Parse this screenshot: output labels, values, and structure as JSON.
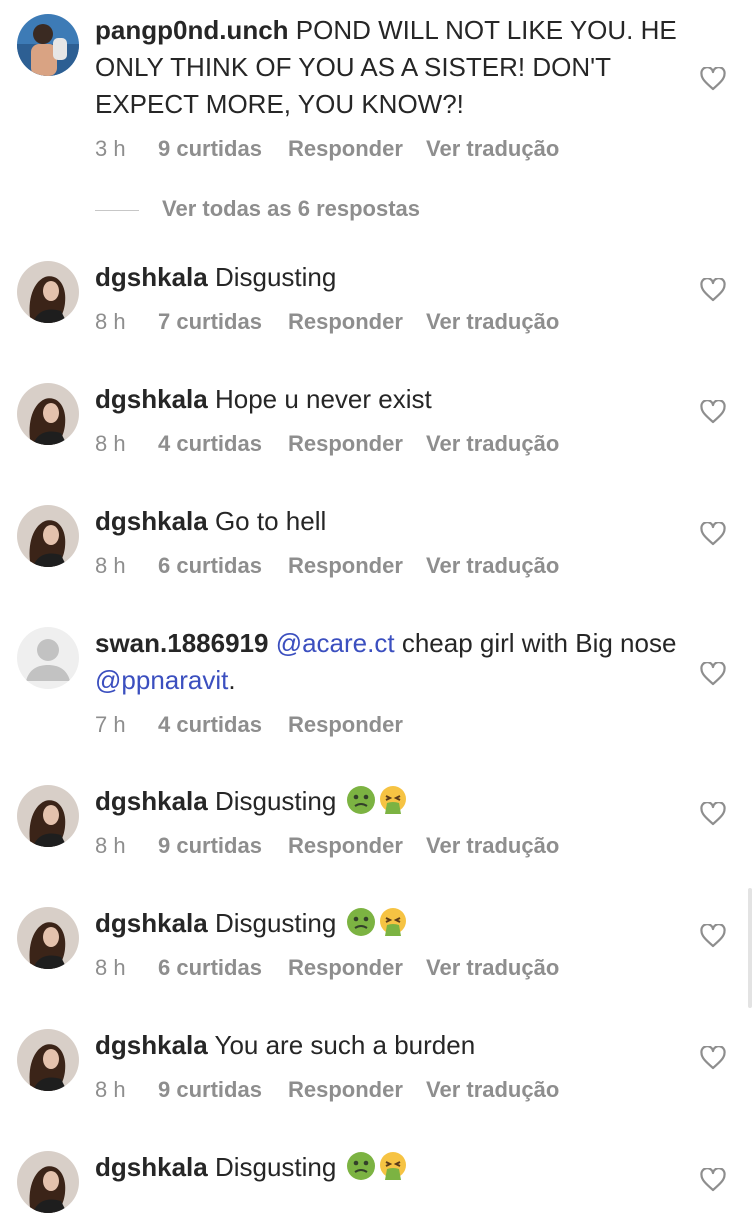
{
  "comments": [
    {
      "username": "pangp0nd.unch",
      "text": "POND WILL NOT LIKE YOU. HE ONLY THINK OF YOU AS A SISTER! DON'T EXPECT MORE, YOU KNOW?!",
      "time": "3 h",
      "likes": "9 curtidas",
      "reply": "Responder",
      "translate": "Ver tradução",
      "avatar": "profile-photo",
      "view_replies": "Ver todas as 6 respostas"
    },
    {
      "username": "dgshkala",
      "text": "Disgusting",
      "time": "8 h",
      "likes": "7 curtidas",
      "reply": "Responder",
      "translate": "Ver tradução",
      "avatar": "profile-photo"
    },
    {
      "username": "dgshkala",
      "text": "Hope u never exist",
      "time": "8 h",
      "likes": "4 curtidas",
      "reply": "Responder",
      "translate": "Ver tradução",
      "avatar": "profile-photo"
    },
    {
      "username": "dgshkala",
      "text": "Go to hell",
      "time": "8 h",
      "likes": "6 curtidas",
      "reply": "Responder",
      "translate": "Ver tradução",
      "avatar": "profile-photo"
    },
    {
      "username": "swan.1886919",
      "mention1": "@acare.ct",
      "text_middle": " cheap girl with Big nose ",
      "mention2": "@ppnaravit",
      "text_end": ".",
      "time": "7 h",
      "likes": "4 curtidas",
      "reply": "Responder",
      "avatar": "default-avatar"
    },
    {
      "username": "dgshkala",
      "text": "Disgusting",
      "emojis": [
        "nauseated-face",
        "vomiting-face"
      ],
      "time": "8 h",
      "likes": "9 curtidas",
      "reply": "Responder",
      "translate": "Ver tradução",
      "avatar": "profile-photo"
    },
    {
      "username": "dgshkala",
      "text": "Disgusting",
      "emojis": [
        "nauseated-face",
        "vomiting-face"
      ],
      "time": "8 h",
      "likes": "6 curtidas",
      "reply": "Responder",
      "translate": "Ver tradução",
      "avatar": "profile-photo"
    },
    {
      "username": "dgshkala",
      "text": "You are such a burden",
      "time": "8 h",
      "likes": "9 curtidas",
      "reply": "Responder",
      "translate": "Ver tradução",
      "avatar": "profile-photo"
    },
    {
      "username": "dgshkala",
      "text": "Disgusting",
      "emojis": [
        "nauseated-face",
        "vomiting-face"
      ],
      "avatar": "profile-photo"
    }
  ],
  "colors": {
    "text": "#262626",
    "secondary": "#8e8e8e",
    "mention": "#3b4fbf",
    "emoji_green": "#7cb342",
    "emoji_yellow": "#f6c343"
  }
}
